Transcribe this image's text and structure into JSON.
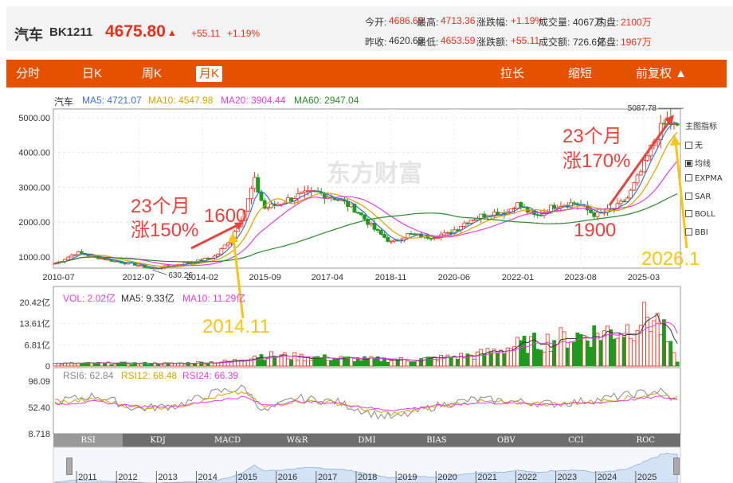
{
  "header": {
    "name": "汽车",
    "code": "BK1211",
    "price": "4675.80",
    "arrow": "▲",
    "change": "+55.11",
    "change_pct": "+1.19%",
    "quotes": [
      {
        "label": "今开:",
        "value": "4686.69",
        "color": "red"
      },
      {
        "label": "最高:",
        "value": "4713.36",
        "color": "red"
      },
      {
        "label": "涨跌幅:",
        "value": "+1.19%",
        "color": "red"
      },
      {
        "label": "成交量:",
        "value": "4067万",
        "color": "dark"
      },
      {
        "label": "内盘:",
        "value": "2100万",
        "color": "red"
      },
      {
        "label": "昨收:",
        "value": "4620.69",
        "color": "dark"
      },
      {
        "label": "最低:",
        "value": "4653.59",
        "color": "red"
      },
      {
        "label": "涨跌额:",
        "value": "+55.11",
        "color": "red"
      },
      {
        "label": "成交额:",
        "value": "726.6亿",
        "color": "dark"
      },
      {
        "label": "外盘:",
        "value": "1967万",
        "color": "red"
      }
    ]
  },
  "tabs": {
    "left": [
      "分时",
      "日K",
      "周K",
      "月K"
    ],
    "active": "月K",
    "right": [
      "拉长",
      "缩短",
      "前复权 ▲"
    ]
  },
  "legend_main": {
    "name": "汽车",
    "items": [
      {
        "text": "MA5: 4721.07",
        "color": "#3f6fd1"
      },
      {
        "text": "MA10: 4547.98",
        "color": "#d8a200"
      },
      {
        "text": "MA20: 3904.44",
        "color": "#e040e0"
      },
      {
        "text": "MA60: 2947.04",
        "color": "#2a8a2a"
      }
    ]
  },
  "legend_vol": [
    {
      "text": "VOL: 2.02亿",
      "color": "#e040e0"
    },
    {
      "text": "MA5: 9.33亿",
      "color": "#333333"
    },
    {
      "text": "MA10: 11.29亿",
      "color": "#e040e0"
    }
  ],
  "legend_rsi": [
    {
      "text": "RSI6: 62.84",
      "color": "#888888"
    },
    {
      "text": "RSI12: 68.48",
      "color": "#d8a200"
    },
    {
      "text": "RSI24: 66.39",
      "color": "#e040e0"
    }
  ],
  "side_panel": {
    "title": "主图指标",
    "items": [
      {
        "label": "无",
        "checked": false
      },
      {
        "label": "均线",
        "checked": true
      },
      {
        "label": "EXPMA",
        "checked": false
      },
      {
        "label": "SAR",
        "checked": false
      },
      {
        "label": "BOLL",
        "checked": false
      },
      {
        "label": "BBI",
        "checked": false
      }
    ]
  },
  "indicators": [
    "RSI",
    "KDJ",
    "MACD",
    "W&R",
    "DMI",
    "BIAS",
    "OBV",
    "CCI",
    "ROC"
  ],
  "indicator_selected": "RSI",
  "nav_years": [
    "2011",
    "2012",
    "2013",
    "2014",
    "2015",
    "2016",
    "2017",
    "2018",
    "2019",
    "2020",
    "2021",
    "2022",
    "2023",
    "2024",
    "2025"
  ],
  "watermark": "东方财富",
  "annotations": {
    "left_title": "23个月",
    "left_gain": "涨150%",
    "left_value": "1600",
    "left_date": "2014.11",
    "right_title": "23个月",
    "right_gain": "涨170%",
    "right_value": "1900",
    "right_date": "2026.1"
  },
  "chart_data": [
    {
      "type": "line",
      "title": "汽车 BK1211 月K",
      "x_tick_labels": [
        "2010-07",
        "2012-07",
        "2014-02",
        "2015-09",
        "2017-04",
        "2018-11",
        "2020-06",
        "2022-01",
        "2023-08",
        "2025-03"
      ],
      "y_tick_labels": [
        "5000.00",
        "4000.00",
        "3000.00",
        "2000.00",
        "1000.00"
      ],
      "ylim": [
        680,
        5250
      ],
      "price_labels": [
        {
          "label": "5087.78",
          "x": 2025.8,
          "y": 5087.78
        },
        {
          "label": "630.26",
          "x": 2012.9,
          "y": 630.26
        }
      ],
      "x": [
        2010.5,
        2011.0,
        2011.5,
        2012.0,
        2012.5,
        2012.9,
        2013.5,
        2014.0,
        2014.5,
        2014.9,
        2015.2,
        2015.45,
        2015.7,
        2016.0,
        2016.5,
        2017.0,
        2017.5,
        2018.0,
        2018.5,
        2018.9,
        2019.3,
        2019.8,
        2020.3,
        2020.8,
        2021.3,
        2021.8,
        2022.0,
        2022.5,
        2023.0,
        2023.5,
        2024.0,
        2024.5,
        2024.8,
        2025.2,
        2025.5,
        2025.8,
        2026.0
      ],
      "series": [
        {
          "name": "",
          "values": [
            820,
            1130,
            1000,
            870,
            780,
            660,
            780,
            870,
            1030,
            1600,
            2300,
            3200,
            2400,
            2500,
            2750,
            2850,
            2700,
            2350,
            1750,
            1400,
            1650,
            1580,
            1660,
            2050,
            2250,
            2300,
            2550,
            2150,
            2500,
            2550,
            2200,
            2400,
            2700,
            3600,
            4450,
            4950,
            4680
          ]
        }
      ]
    },
    {
      "type": "bar",
      "title": "VOL",
      "y_tick_labels": [
        "20.42亿",
        "13.61亿",
        "6.81亿",
        "0"
      ],
      "ylim": [
        0,
        20.42
      ],
      "series": [
        {
          "name": "VOL",
          "x": [
            2010.5,
            2012.0,
            2013.5,
            2014.9,
            2015.45,
            2016.5,
            2018.0,
            2019.5,
            2021.0,
            2022.0,
            2023.0,
            2024.0,
            2024.8,
            2025.2,
            2025.6,
            2026.0
          ],
          "values": [
            0.8,
            0.9,
            0.8,
            1.5,
            3.5,
            3.0,
            2.2,
            2.0,
            3.5,
            6.5,
            8.5,
            10.5,
            12.0,
            17.5,
            13.5,
            2.0
          ]
        }
      ]
    },
    {
      "type": "line",
      "title": "RSI",
      "y_tick_labels": [
        "96.09",
        "52.40",
        "8.718"
      ],
      "ylim": [
        8.718,
        96.09
      ],
      "x": [
        2010.5,
        2011.5,
        2012.5,
        2013.5,
        2014.5,
        2015.2,
        2015.7,
        2016.5,
        2017.5,
        2018.5,
        2019.0,
        2020.0,
        2021.0,
        2022.0,
        2023.0,
        2024.0,
        2025.0,
        2025.6,
        2026.0
      ],
      "series": [
        {
          "name": "RSI6",
          "values": [
            62.84,
            72,
            50,
            55,
            78,
            85,
            45,
            68,
            62,
            40,
            35,
            55,
            66,
            62,
            58,
            65,
            75,
            80,
            62.84
          ]
        },
        {
          "name": "RSI12",
          "values": [
            60,
            66,
            52,
            54,
            70,
            78,
            52,
            64,
            60,
            45,
            42,
            54,
            62,
            60,
            58,
            62,
            70,
            75,
            68.48
          ]
        },
        {
          "name": "RSI24",
          "values": [
            58,
            62,
            54,
            55,
            64,
            70,
            56,
            62,
            60,
            50,
            48,
            55,
            60,
            59,
            58,
            60,
            66,
            70,
            66.39
          ]
        }
      ]
    }
  ]
}
